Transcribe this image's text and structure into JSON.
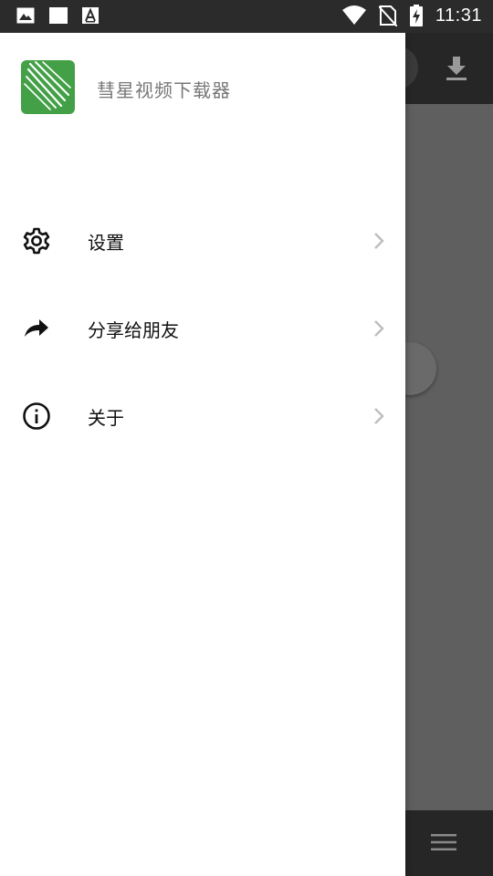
{
  "status_bar": {
    "time": "11:31",
    "icons": [
      "image-icon",
      "square-icon",
      "font-a-icon",
      "wifi-icon",
      "no-sim-icon",
      "battery-charging-icon"
    ]
  },
  "drawer": {
    "app_name": "彗星视频下载器",
    "logo_color": "#43a047",
    "items": [
      {
        "label": "设置",
        "icon": "gear-icon"
      },
      {
        "label": "分享给朋友",
        "icon": "share-icon"
      },
      {
        "label": "关于",
        "icon": "info-icon"
      }
    ]
  },
  "background": {
    "toolbar_icon": "download-icon",
    "bottom_icon": "menu-icon"
  }
}
